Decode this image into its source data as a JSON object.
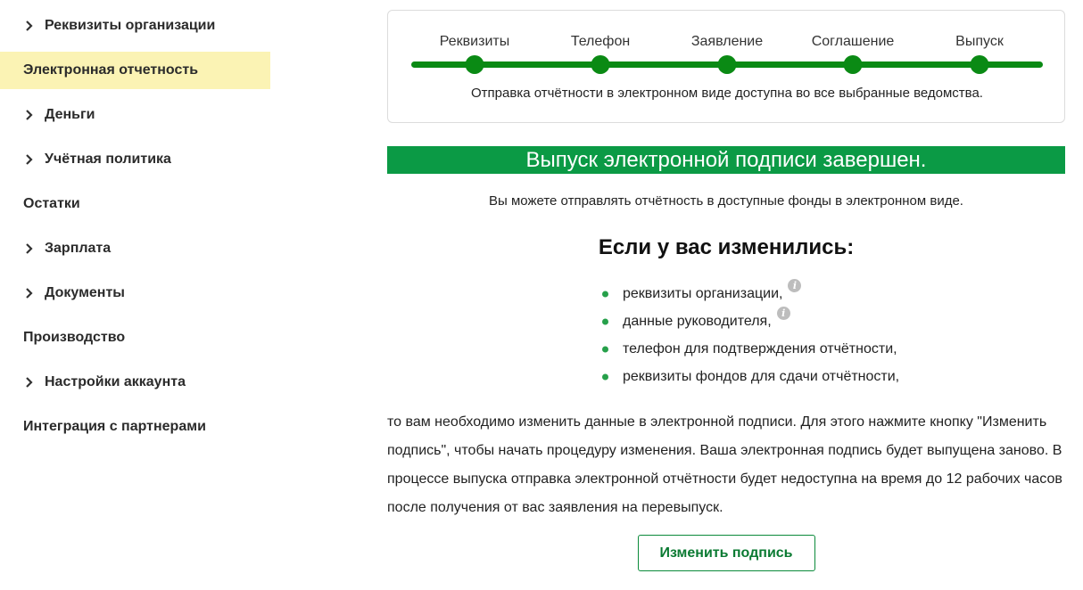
{
  "sidebar": {
    "items": [
      {
        "label": "Реквизиты организации",
        "expandable": true
      },
      {
        "label": "Электронная отчетность",
        "expandable": false,
        "active": true
      },
      {
        "label": "Деньги",
        "expandable": true
      },
      {
        "label": "Учётная политика",
        "expandable": true
      },
      {
        "label": "Остатки",
        "expandable": false
      },
      {
        "label": "Зарплата",
        "expandable": true
      },
      {
        "label": "Документы",
        "expandable": true
      },
      {
        "label": "Производство",
        "expandable": false
      },
      {
        "label": "Настройки аккаунта",
        "expandable": true
      },
      {
        "label": "Интеграция с партнерами",
        "expandable": false
      }
    ]
  },
  "stepper": {
    "steps": [
      "Реквизиты",
      "Телефон",
      "Заявление",
      "Соглашение",
      "Выпуск"
    ],
    "completed_steps": 5,
    "note": "Отправка отчётности в электронном виде доступна во все выбранные ведомства."
  },
  "banner": {
    "text": "Выпуск электронной подписи завершен."
  },
  "subtitle": "Вы можете отправлять отчётность в доступные фонды в электронном виде.",
  "changes": {
    "title": "Если у вас изменились:",
    "items": [
      {
        "text": "реквизиты организации,",
        "info": true
      },
      {
        "text": "данные руководителя,",
        "info": true
      },
      {
        "text": "телефон для подтверждения отчётности,",
        "info": false
      },
      {
        "text": "реквизиты фондов для сдачи отчётности,",
        "info": false
      }
    ]
  },
  "paragraph": "то вам необходимо изменить данные в электронной подписи. Для этого нажмите кнопку \"Изменить подпись\", чтобы начать процедуру изменения. Ваша электронная подпись будет выпущена заново. В процессе выпуска отправка электронной отчётности будет недоступна на время до 12 рабочих часов после получения от вас заявления на перевыпуск.",
  "button": {
    "label": "Изменить подпись"
  },
  "colors": {
    "accent_green": "#0a8a14",
    "banner_green": "#0b9a45",
    "active_highlight": "#fbf3b4",
    "info_icon": "#bdbdbd"
  },
  "icons": {
    "chevron": "chevron-right-icon",
    "info": "info-icon",
    "info_glyph": "i"
  }
}
